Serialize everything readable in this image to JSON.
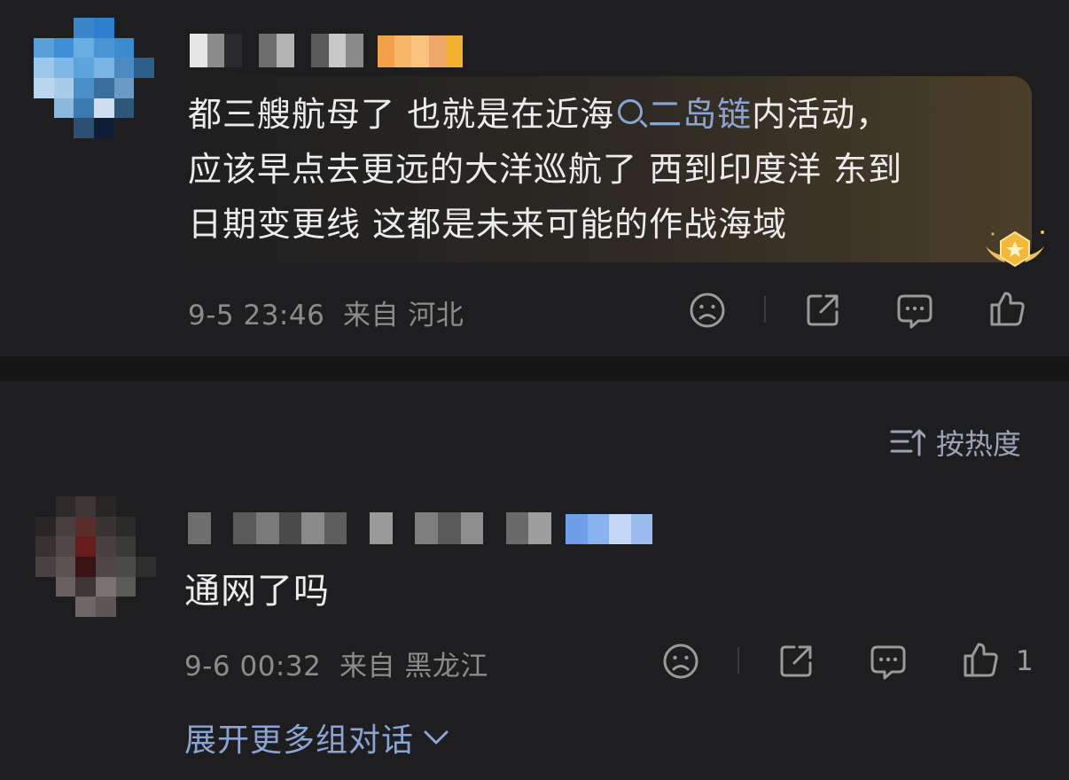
{
  "comments": [
    {
      "text_before_link": "都三艘航母了 也就是在近海",
      "link_text": "二岛链",
      "text_after_link": "内活动，",
      "text_line2": "应该早点去更远的大洋巡航了 西到印度洋 东到",
      "text_line3": "日期变更线 这都是未来可能的作战海域",
      "time": "9-5 23:46",
      "location": "来自 河北"
    },
    {
      "text": "通网了吗",
      "time": "9-6 00:32",
      "location": "来自 黑龙江",
      "like_count": "1"
    }
  ],
  "sort": {
    "label": "按热度"
  },
  "expand": {
    "label": "展开更多组对话"
  },
  "icons": [
    "sad-face-icon",
    "share-icon",
    "comment-icon",
    "thumbs-up-icon",
    "sort-icon",
    "chevron-down-icon",
    "medal-icon",
    "search-link-icon"
  ],
  "colors": {
    "background": "#1e1e20",
    "link": "#8aa4d4",
    "meta": "#8c8c8c",
    "divider": "#151516"
  }
}
